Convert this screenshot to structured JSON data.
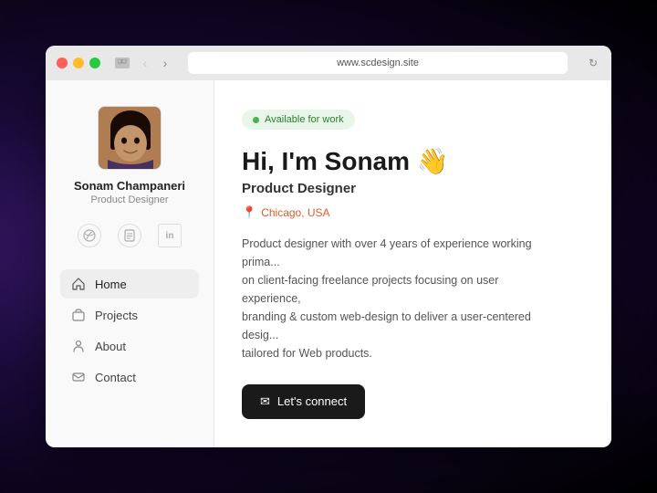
{
  "browser": {
    "url": "www.scdesign.site",
    "traffic_lights": [
      "red",
      "yellow",
      "green"
    ]
  },
  "sidebar": {
    "user": {
      "name": "Sonam Champaneri",
      "title": "Product Designer"
    },
    "social_icons": [
      {
        "name": "dribbble",
        "symbol": "⊕"
      },
      {
        "name": "document",
        "symbol": "◻"
      },
      {
        "name": "linkedin",
        "symbol": "in"
      }
    ],
    "nav_items": [
      {
        "id": "home",
        "label": "Home",
        "active": true
      },
      {
        "id": "projects",
        "label": "Projects",
        "active": false
      },
      {
        "id": "about",
        "label": "About",
        "active": false
      },
      {
        "id": "contact",
        "label": "Contact",
        "active": false
      }
    ]
  },
  "main": {
    "availability": "Available for work",
    "hero_title": "Hi, I'm Sonam 👋",
    "hero_subtitle": "Product Designer",
    "location": "Chicago, USA",
    "bio": "Product designer with over 4 years of experience working prima... on client-facing freelance projects focusing on user experience, branding & custom web-design to deliver a user-centered desig... tailored for Web products.",
    "cta_label": "Let's connect",
    "cta_icon": "✉"
  },
  "colors": {
    "accent_green": "#4caf50",
    "accent_green_bg": "#e8f5e9",
    "location_color": "#e05c2a",
    "cta_bg": "#1a1a1a"
  }
}
